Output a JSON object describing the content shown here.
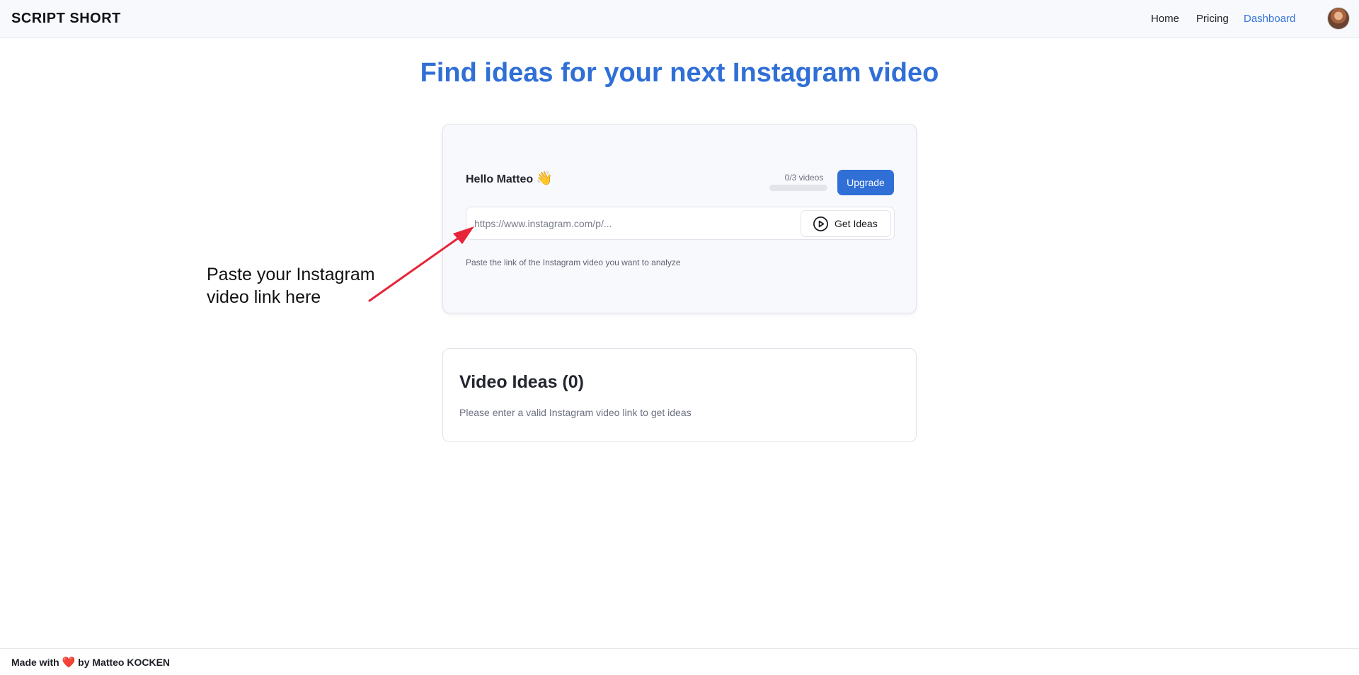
{
  "header": {
    "brand": "SCRIPT SHORT",
    "nav": [
      {
        "label": "Home",
        "active": false
      },
      {
        "label": "Pricing",
        "active": false
      },
      {
        "label": "Dashboard",
        "active": true
      }
    ],
    "avatar_icon": "user-avatar"
  },
  "main": {
    "headline": "Find ideas for your next Instagram video",
    "card": {
      "greeting": "Hello Matteo",
      "greeting_emoji": "👋",
      "usage_label": "0/3 videos",
      "usage_fraction": 0,
      "upgrade_label": "Upgrade",
      "url_placeholder": "https://www.instagram.com/p/...",
      "url_value": "",
      "get_ideas_label": "Get Ideas",
      "get_ideas_icon": "play-circle-icon",
      "hint": "Paste the link of the Instagram video you want to analyze"
    },
    "annotation": {
      "line1": "Paste your Instagram",
      "line2": "video link here",
      "arrow_color": "#e8243a"
    },
    "ideas": {
      "title": "Video Ideas (0)",
      "empty_message": "Please enter a valid Instagram video link to get ideas"
    }
  },
  "footer": {
    "prefix": "Made with",
    "heart": "❤️",
    "suffix": "by Matteo KOCKEN"
  },
  "colors": {
    "accent": "#2f6fd6",
    "nav_active": "#3474d8",
    "arrow": "#e8243a"
  }
}
